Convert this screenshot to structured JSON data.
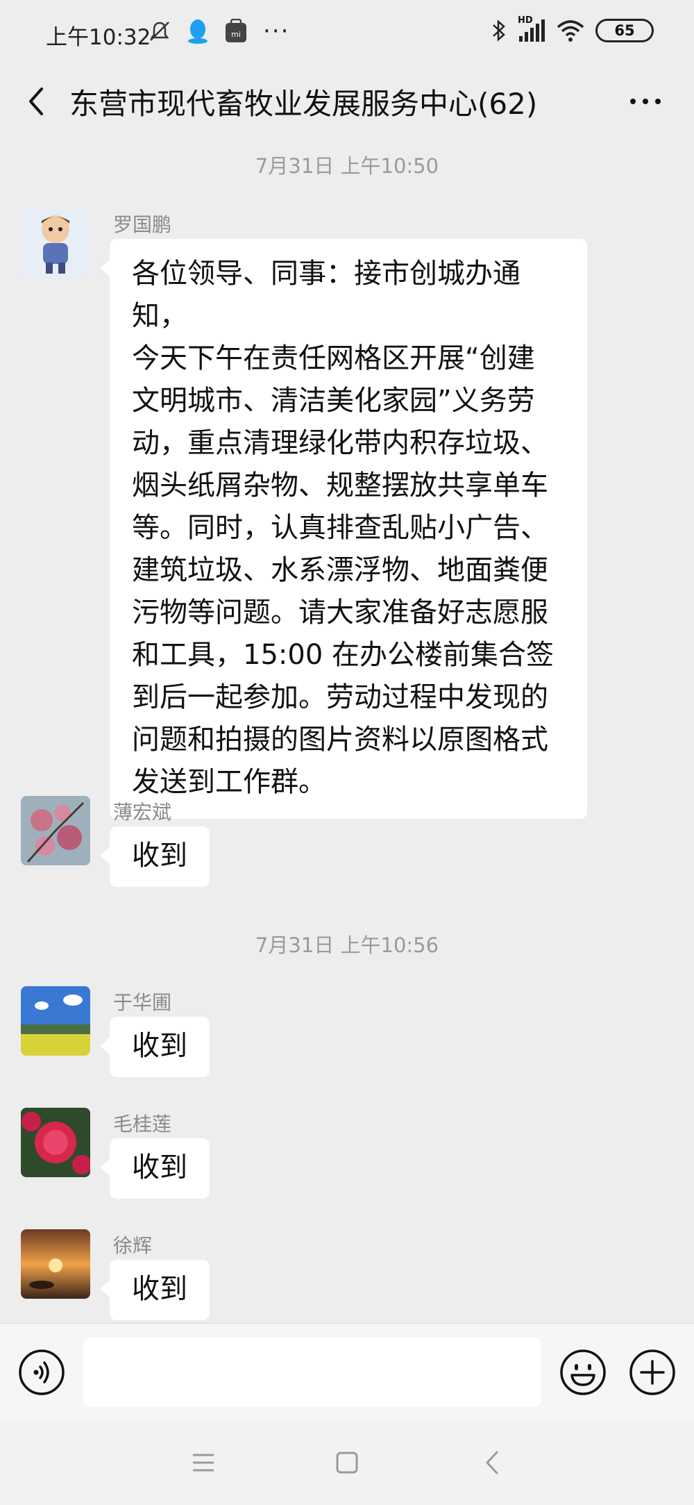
{
  "status_bar": {
    "time": "上午10:32",
    "battery": "65",
    "network": "HD"
  },
  "header": {
    "title": "东营市现代畜牧业发展服务中心(62)"
  },
  "chat": {
    "timestamps": [
      "7月31日 上午10:50",
      "7月31日 上午10:56"
    ],
    "messages": [
      {
        "sender": "罗国鹏",
        "lines": [
          "各位领导、同事：接市创城办通知，",
          "今天下午在责任网格区开展“创建",
          "文明城市、清洁美化家园”义务劳",
          "动，重点清理绿化带内积存垃圾、",
          "烟头纸屑杂物、规整摆放共享单车",
          "等。同时，认真排查乱贴小广告、",
          "建筑垃圾、水系漂浮物、地面粪便",
          "污物等问题。请大家准备好志愿服",
          "和工具，15:00 在办公楼前集合签",
          "到后一起参加。劳动过程中发现的",
          "问题和拍摄的图片资料以原图格式",
          "发送到工作群。"
        ]
      },
      {
        "sender": "薄宏斌",
        "text": "收到"
      },
      {
        "sender": "于华圃",
        "text": "收到"
      },
      {
        "sender": "毛桂莲",
        "text": "收到"
      },
      {
        "sender": "徐辉",
        "text": "收到"
      }
    ]
  },
  "input": {
    "placeholder": ""
  },
  "colors": {
    "background": "#ededed",
    "bubble": "#ffffff",
    "meta_text": "#9a9a9a"
  },
  "icons": [
    "back-arrow-icon",
    "more-icon",
    "voice-icon",
    "emoji-icon",
    "plus-icon",
    "menu-nav-icon",
    "home-nav-icon",
    "back-nav-icon",
    "bluetooth-icon",
    "signal-icon",
    "wifi-icon",
    "qq-icon",
    "mi-icon",
    "mute-icon"
  ]
}
